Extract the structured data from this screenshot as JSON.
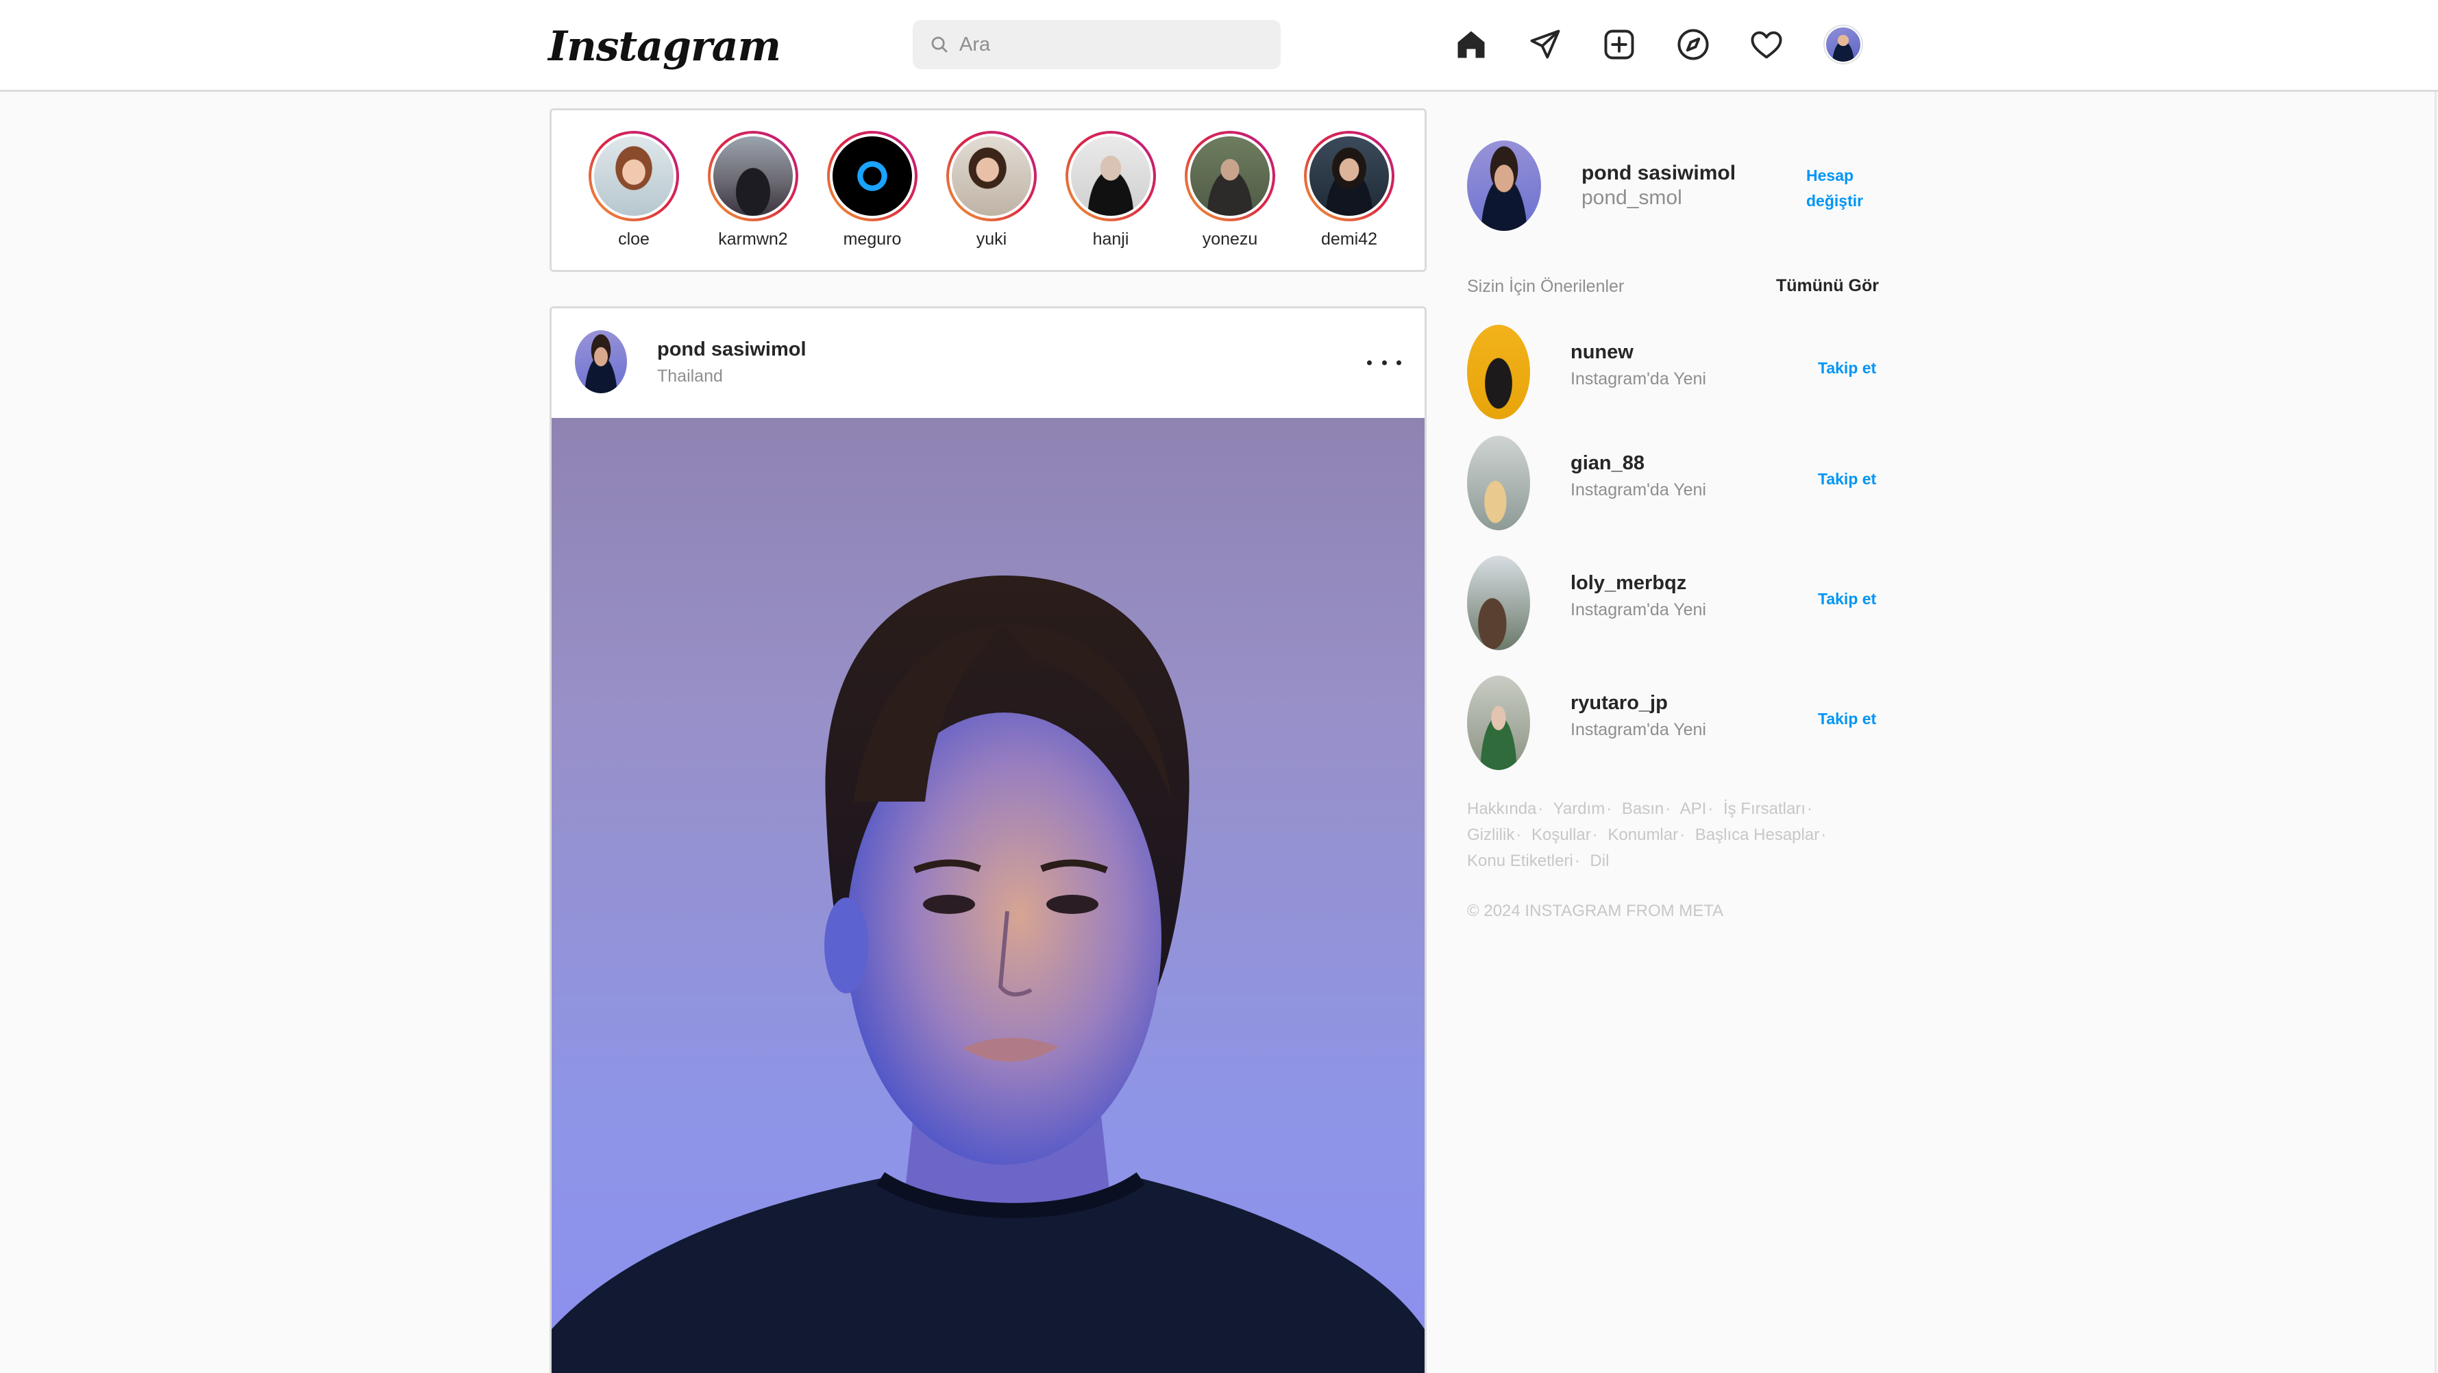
{
  "app": {
    "logo_text": "Instagram"
  },
  "search": {
    "placeholder": "Ara"
  },
  "nav": {
    "icons": [
      "home-icon",
      "direct-message-icon",
      "new-post-icon",
      "explore-icon",
      "activity-heart-icon"
    ]
  },
  "stories": [
    {
      "name": "cloe"
    },
    {
      "name": "karmwn2"
    },
    {
      "name": "meguro"
    },
    {
      "name": "yuki"
    },
    {
      "name": "hanji"
    },
    {
      "name": "yonezu"
    },
    {
      "name": "demi42"
    }
  ],
  "post": {
    "username": "pond sasiwimol",
    "location": "Thailand"
  },
  "profile": {
    "name": "pond sasiwimol",
    "handle": "pond_smol",
    "switch_label_line1": "Hesap",
    "switch_label_line2": "değiştir"
  },
  "suggestions": {
    "title": "Sizin İçin Önerilenler",
    "see_all": "Tümünü Gör",
    "items": [
      {
        "username": "nunew",
        "subtitle": "Instagram'da Yeni",
        "action": "Takip et"
      },
      {
        "username": "gian_88",
        "subtitle": "Instagram'da Yeni",
        "action": "Takip et"
      },
      {
        "username": "loly_merbqz",
        "subtitle": "Instagram'da Yeni",
        "action": "Takip et"
      },
      {
        "username": "ryutaro_jp",
        "subtitle": "Instagram'da Yeni",
        "action": "Takip et"
      }
    ]
  },
  "footer": {
    "links": [
      "Hakkında",
      "Yardım",
      "Basın",
      "API",
      "İş Fırsatları",
      "Gizlilik",
      "Koşullar",
      "Konumlar",
      "Başlıca Hesaplar",
      "Konu Etiketleri",
      "Dil"
    ],
    "copyright": "© 2024 INSTAGRAM FROM META"
  },
  "colors": {
    "accent": "#0095f6",
    "border": "#dbdbdb",
    "background": "#fafafa",
    "muted_text": "#8e8e8e"
  }
}
